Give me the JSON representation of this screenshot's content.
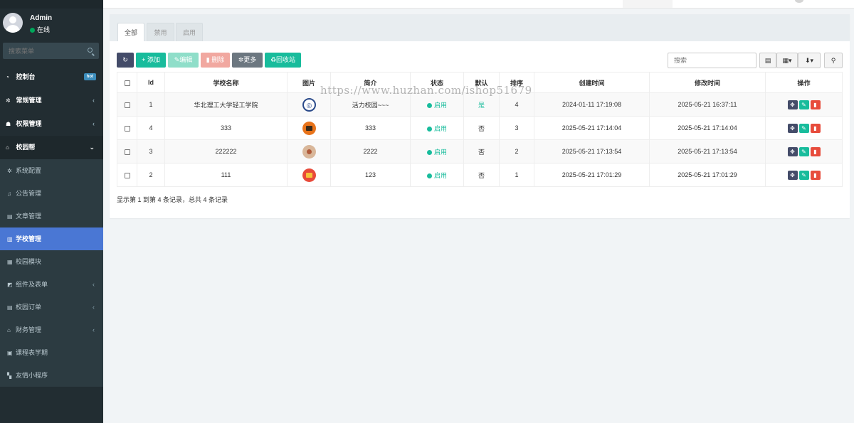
{
  "sidebar": {
    "user": {
      "name": "Admin",
      "status": "在线"
    },
    "search_placeholder": "搜索菜单",
    "menu": [
      {
        "label": "控制台",
        "icon": "dashboard-icon",
        "badge": "hot"
      },
      {
        "label": "常规管理",
        "icon": "cogs-icon",
        "caret": "‹"
      },
      {
        "label": "权限管理",
        "icon": "users-icon",
        "caret": "‹"
      },
      {
        "label": "校园帮",
        "icon": "university-icon",
        "caret": "⌄"
      }
    ],
    "submenu": [
      {
        "label": "系统配置",
        "icon": "cogs-icon"
      },
      {
        "label": "公告管理",
        "icon": "bell-icon"
      },
      {
        "label": "文章管理",
        "icon": "list-icon"
      },
      {
        "label": "学校管理",
        "icon": "book-icon",
        "active": true
      },
      {
        "label": "校园模块",
        "icon": "th-icon"
      },
      {
        "label": "组件及表单",
        "icon": "puzzle-icon",
        "caret": "‹"
      },
      {
        "label": "校园订单",
        "icon": "list-icon",
        "caret": "‹"
      },
      {
        "label": "财务管理",
        "icon": "bank-icon",
        "caret": "‹"
      },
      {
        "label": "课程表学期",
        "icon": "calendar-icon"
      },
      {
        "label": "友情小程序",
        "icon": "th-large-icon"
      }
    ]
  },
  "tabs": [
    "全部",
    "禁用",
    "启用"
  ],
  "toolbar": {
    "add": "添加",
    "edit": "编辑",
    "delete": "删除",
    "more": "更多",
    "recycle": "回收站",
    "search_placeholder": "搜索"
  },
  "table": {
    "headers": [
      "Id",
      "学校名称",
      "图片",
      "简介",
      "状态",
      "默认",
      "排序",
      "创建时间",
      "修改时间",
      "操作"
    ],
    "rows": [
      {
        "id": "1",
        "name": "华北理工大学轻工学院",
        "image": "school-logo-icon",
        "intro": "活力校园~~~",
        "status": "启用",
        "default": "是",
        "sort": "4",
        "created": "2024-01-11 17:19:08",
        "updated": "2025-05-21 16:37:11"
      },
      {
        "id": "4",
        "name": "333",
        "image": "shop-icon",
        "intro": "333",
        "status": "启用",
        "default": "否",
        "sort": "3",
        "created": "2025-05-21 17:14:04",
        "updated": "2025-05-21 17:14:04"
      },
      {
        "id": "3",
        "name": "222222",
        "image": "food-icon",
        "intro": "2222",
        "status": "启用",
        "default": "否",
        "sort": "2",
        "created": "2025-05-21 17:13:54",
        "updated": "2025-05-21 17:13:54"
      },
      {
        "id": "2",
        "name": "111",
        "image": "gift-icon",
        "intro": "123",
        "status": "启用",
        "default": "否",
        "sort": "1",
        "created": "2025-05-21 17:01:29",
        "updated": "2025-05-21 17:01:29"
      }
    ]
  },
  "pagination_text": "显示第 1 到第 4 条记录，总共 4 条记录",
  "watermark": "https://www.huzhan.com/ishop51679",
  "colors": {
    "sidebar": "#222d32",
    "active": "#4a77d4",
    "teal": "#18bc9c",
    "red": "#e74c3c",
    "dark": "#444c69"
  }
}
